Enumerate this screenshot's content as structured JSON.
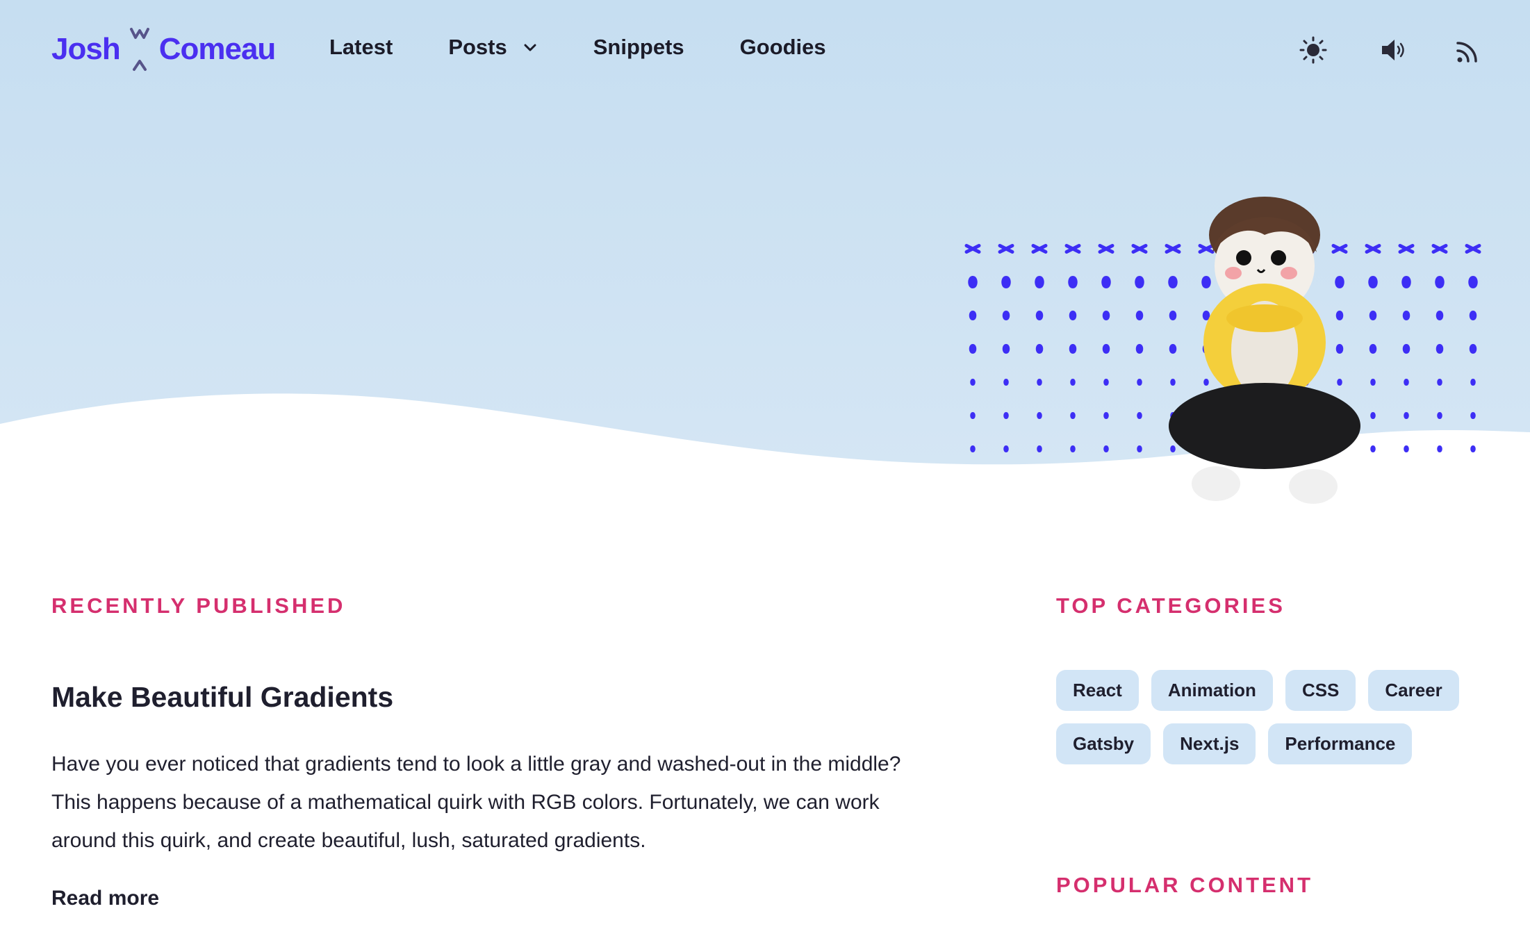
{
  "header": {
    "logo_first": "Josh",
    "logo_last": "Comeau",
    "nav": [
      {
        "label": "Latest"
      },
      {
        "label": "Posts"
      },
      {
        "label": "Snippets"
      },
      {
        "label": "Goodies"
      }
    ],
    "icons": [
      "sun-icon",
      "speaker-icon",
      "rss-icon"
    ]
  },
  "colors": {
    "brand": "#4a2ff0",
    "accent": "#d52f6e",
    "hero_bg": "#c6def1",
    "tag_bg": "#d2e5f6"
  },
  "recent": {
    "label": "RECENTLY PUBLISHED",
    "post_title": "Make Beautiful Gradients",
    "post_body": "Have you ever noticed that gradients tend to look a little gray and washed-out in the middle? This happens because of a mathematical quirk with RGB colors. Fortunately, we can work around this quirk, and create beautiful, lush, saturated gradients.",
    "read_more": "Read more"
  },
  "categories": {
    "label": "TOP CATEGORIES",
    "tags": [
      "React",
      "Animation",
      "CSS",
      "Career",
      "Gatsby",
      "Next.js",
      "Performance"
    ]
  },
  "popular": {
    "label": "POPULAR CONTENT"
  }
}
